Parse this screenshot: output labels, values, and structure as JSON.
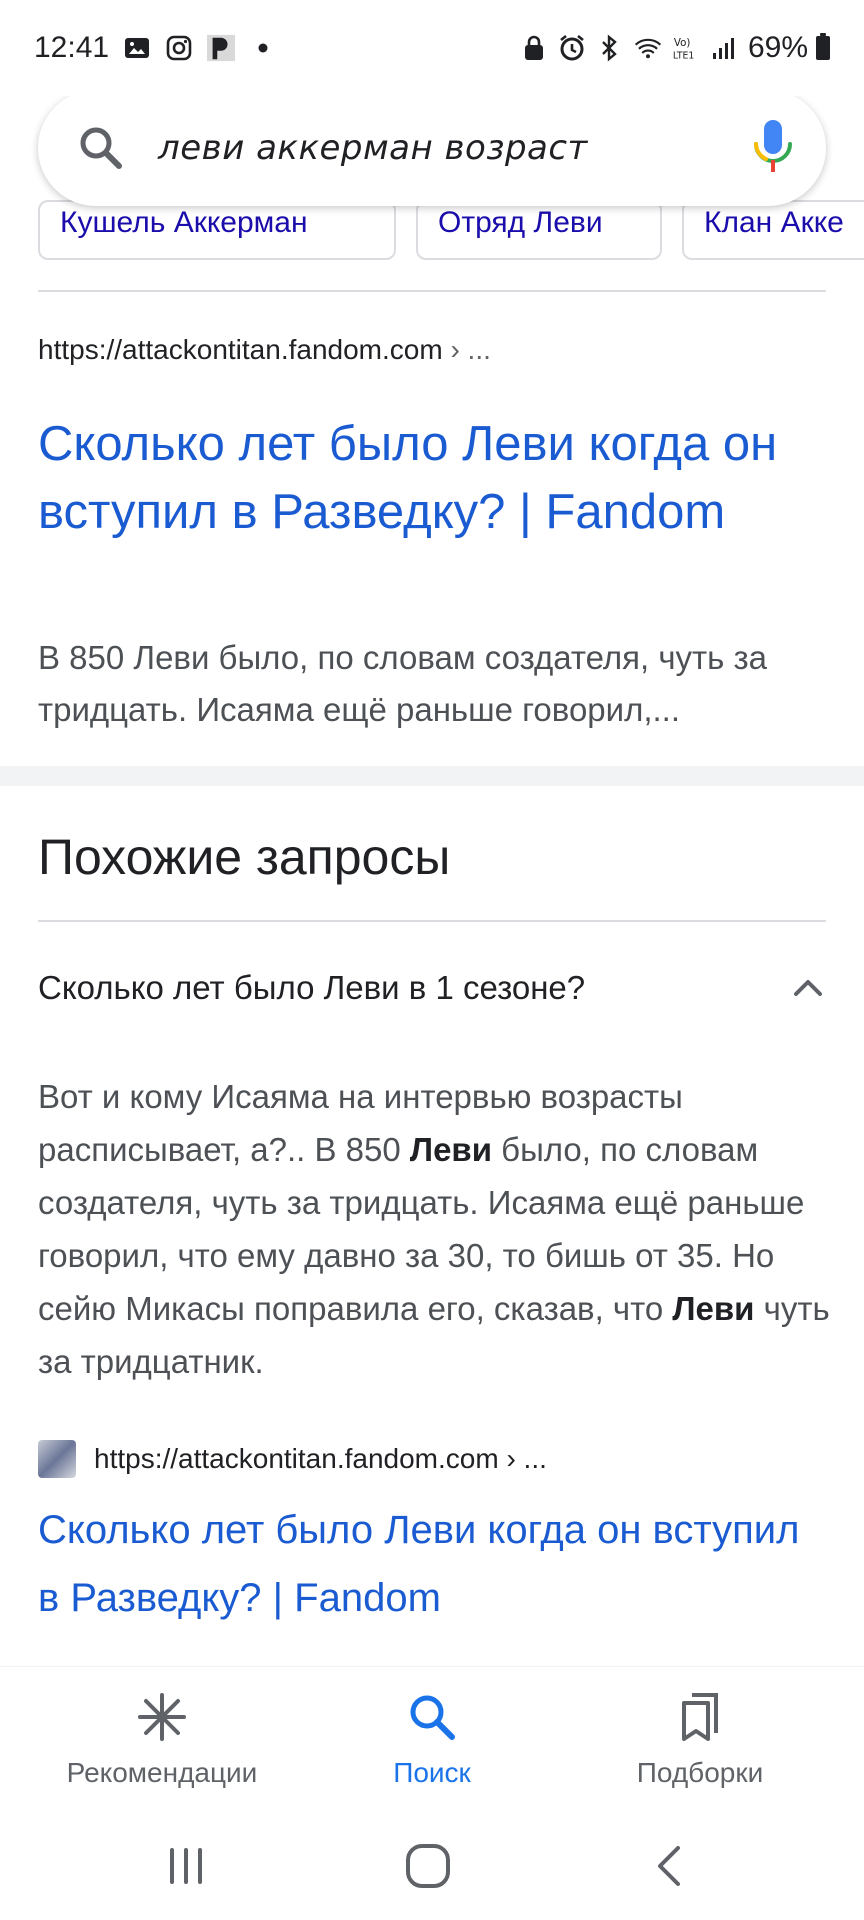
{
  "status_bar": {
    "time": "12:41",
    "battery": "69%"
  },
  "search": {
    "query": "леви аккерман возраст"
  },
  "chips": [
    "Кушель Аккерман",
    "Отряд Леви",
    "Клан Акке"
  ],
  "result": {
    "url": "https://attackontitan.fandom.com",
    "url_suffix": "› ...",
    "title": "Сколько лет было Леви когда он вступил в Разведку? | Fandom",
    "snippet": "В 850 Леви было, по словам создателя, чуть за тридцать. Исаяма ещё раньше говорил,..."
  },
  "related": {
    "heading": "Похожие запросы",
    "question": "Сколько лет было Леви в 1 сезоне?",
    "answer_parts": {
      "p1": "Вот и кому Исаяма на интервью возрасты расписывает, а?.. В 850 ",
      "b1": "Леви",
      "p2": " было, по словам создателя, чуть за тридцать. Исаяма ещё раньше говорил, что ему давно за 30, то бишь от 35. Но сейю Микасы поправила его, сказав, что ",
      "b2": "Леви",
      "p3": " чуть за тридцатник."
    },
    "source_url": "https://attackontitan.fandom.com",
    "source_url_suffix": "› ...",
    "source_title": "Сколько лет было Леви когда он вступил в Разведку? | Fandom"
  },
  "bottom_nav": {
    "items": [
      {
        "label": "Рекомендации",
        "icon": "asterisk-icon",
        "active": false
      },
      {
        "label": "Поиск",
        "icon": "search-icon",
        "active": true
      },
      {
        "label": "Подборки",
        "icon": "collections-icon",
        "active": false
      }
    ]
  },
  "colors": {
    "link": "#1a5bd1",
    "active_nav": "#1a73e8",
    "text": "#202124",
    "snippet": "#4d5156"
  }
}
